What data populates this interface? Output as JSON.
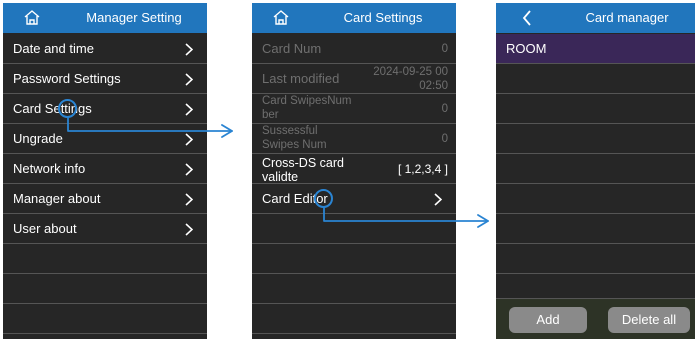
{
  "screen1": {
    "title": "Manager Setting",
    "items": [
      {
        "label": "Date and time"
      },
      {
        "label": "Password Settings"
      },
      {
        "label": "Card Settings"
      },
      {
        "label": "Ungrade"
      },
      {
        "label": "Network info"
      },
      {
        "label": "Manager about"
      },
      {
        "label": "User about"
      }
    ]
  },
  "screen2": {
    "title": "Card Settings",
    "card_num": {
      "label": "Card Num",
      "value": "0"
    },
    "last_modified": {
      "label": "Last modified",
      "value_line1": "2024-09-25 00",
      "value_line2": "02:50"
    },
    "swipes_num": {
      "label_line1": "Card SwipesNum",
      "label_line2": "ber",
      "value": "0"
    },
    "successful": {
      "label_line1": "Sussessful",
      "label_line2": "Swipes Num",
      "value": "0"
    },
    "cross_ds": {
      "label_line1": "Cross-DS card",
      "label_line2": "validte",
      "value": "[ 1,2,3,4 ]"
    },
    "card_editor": {
      "label": "Card Editor"
    }
  },
  "screen3": {
    "title": "Card manager",
    "rooms": [
      "ROOM"
    ],
    "add_label": "Add",
    "delete_label": "Delete all"
  },
  "colors": {
    "header": "#2176bd",
    "screen_bg": "#262626",
    "selected_row": "#3a2758",
    "callout": "#2a84d2"
  }
}
